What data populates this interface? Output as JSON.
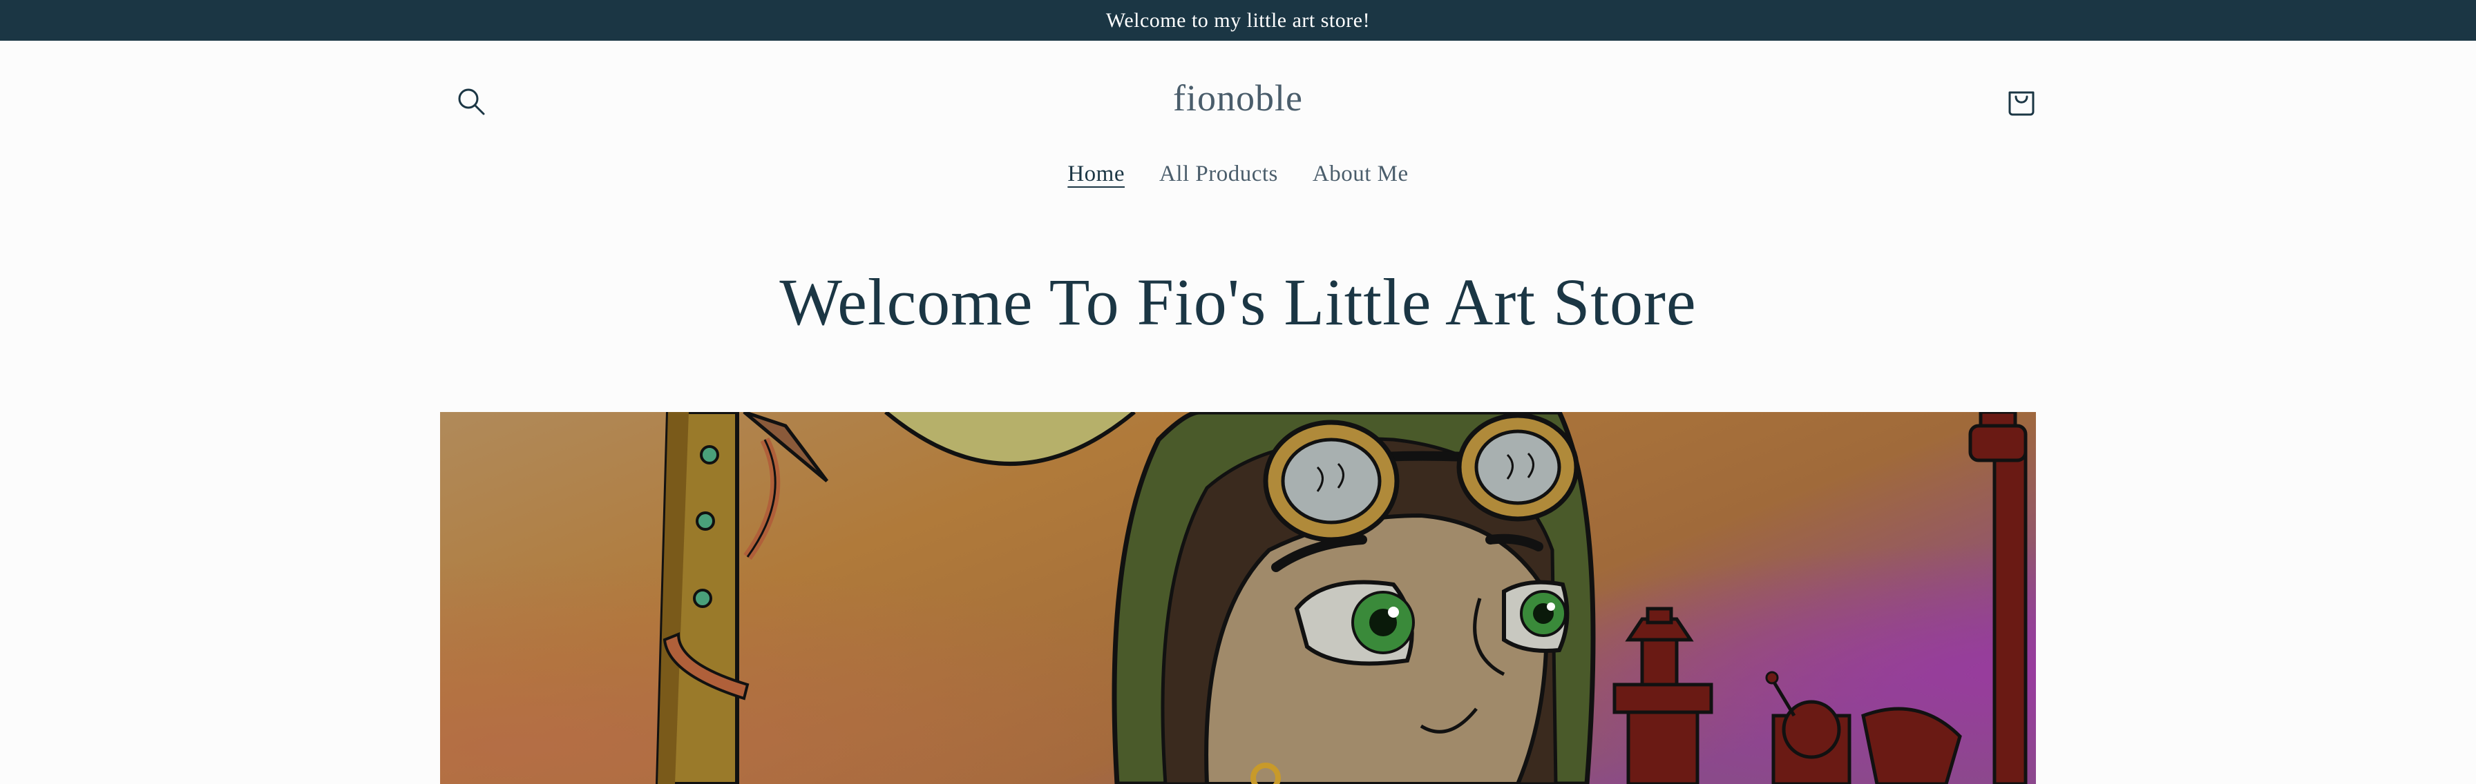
{
  "announcement": {
    "text": "Welcome to my little art store!"
  },
  "header": {
    "logo": "fionoble",
    "search_icon": "search-icon",
    "cart_icon": "cart-icon"
  },
  "nav": {
    "items": [
      {
        "label": "Home",
        "active": true
      },
      {
        "label": "All Products",
        "active": false
      },
      {
        "label": "About Me",
        "active": false
      }
    ]
  },
  "main": {
    "heading": "Welcome To Fio's Little Art Store"
  },
  "hero": {
    "description_icon": "hero-artwork-image"
  },
  "colors": {
    "announcement_bg": "#1b3644",
    "heading": "#1b3644",
    "body_bg": "#fcfcfc",
    "nav_text": "#4a5d6b"
  }
}
